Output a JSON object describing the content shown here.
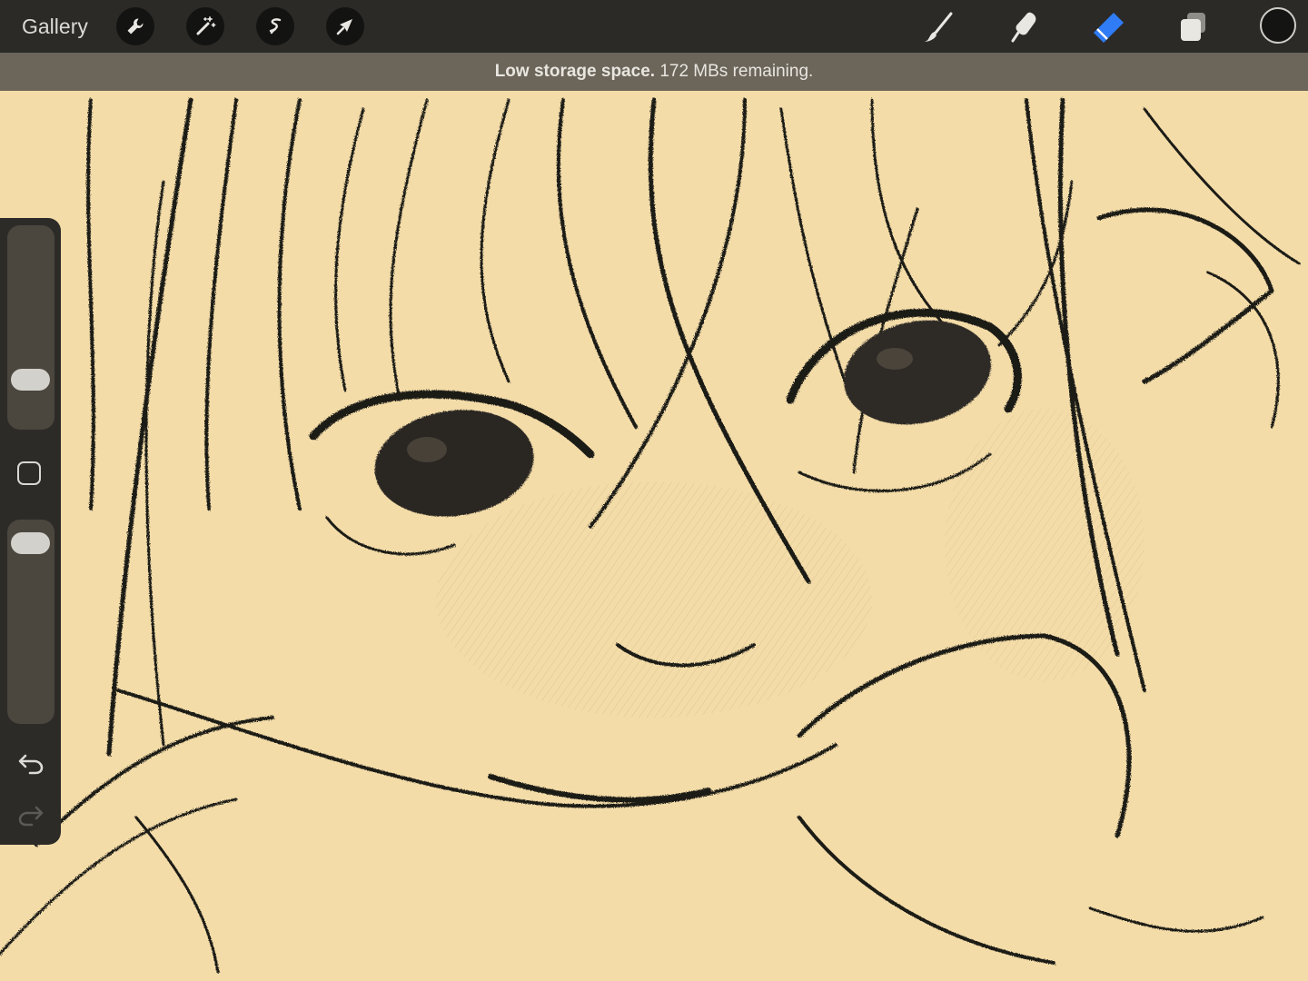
{
  "app": {
    "gallery_label": "Gallery"
  },
  "toolbar": {
    "left_tools": [
      "wrench-icon",
      "magic-wand-icon",
      "selection-icon",
      "move-arrow-icon"
    ],
    "right_tools": [
      "brush-icon",
      "smudge-icon",
      "eraser-icon",
      "layers-icon"
    ],
    "active_tool": "eraser",
    "active_color": "#141413",
    "accent_color": "#2f7cf6"
  },
  "banner": {
    "bold_text": "Low storage space.",
    "detail_text": "172 MBs remaining."
  },
  "sidebar": {
    "brush_size_level": 0.2,
    "opacity_level": 0.05
  },
  "canvas": {
    "paper_color": "#f3dca8",
    "ink_color": "#1c1a16"
  }
}
